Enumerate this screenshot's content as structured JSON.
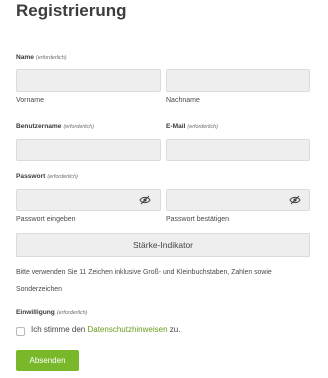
{
  "page": {
    "title": "Registrierung"
  },
  "required_tag": "(erforderlich)",
  "name": {
    "label": "Name",
    "first_sublabel": "Vorname",
    "last_sublabel": "Nachname"
  },
  "username": {
    "label": "Benutzername"
  },
  "email": {
    "label": "E-Mail"
  },
  "password": {
    "label": "Passwort",
    "enter_sublabel": "Passwort eingeben",
    "confirm_sublabel": "Passwort bestätigen",
    "toggle_icon": "eye-slash-icon"
  },
  "strength": {
    "label": "Stärke-Indikator"
  },
  "hint": "Bitte verwenden Sie 11 Zeichen inklusive Groß- und Kleinbuchstaben, Zahlen sowie Sonderzeichen",
  "consent": {
    "label": "Einwilligung",
    "text_before": "Ich stimme den ",
    "link_text": "Datenschutzhinweisen",
    "text_after": " zu.",
    "checked": false
  },
  "submit": {
    "label": "Absenden"
  },
  "colors": {
    "accent": "#78b82a",
    "link": "#6a9a1f",
    "field_bg": "#eeeeee"
  }
}
